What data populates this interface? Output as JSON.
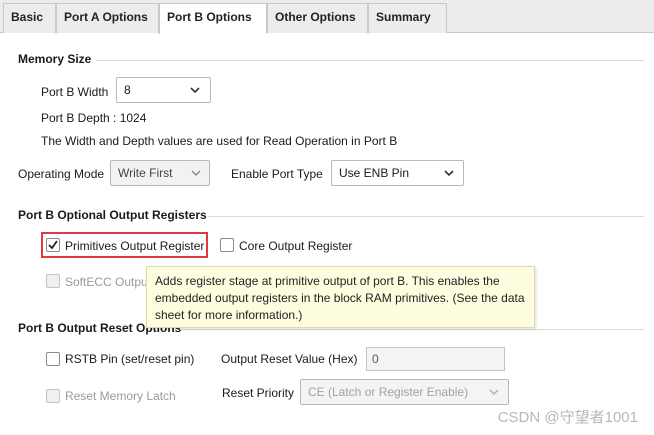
{
  "tabs": [
    {
      "label": "Basic",
      "active": false
    },
    {
      "label": "Port A Options",
      "active": false
    },
    {
      "label": "Port B Options",
      "active": true
    },
    {
      "label": "Other Options",
      "active": false
    },
    {
      "label": "Summary",
      "active": false
    }
  ],
  "memory_size": {
    "heading": "Memory Size",
    "width_label": "Port B Width",
    "width_value": "8",
    "depth_text": "Port B Depth : 1024",
    "note": "The Width and Depth values are used for Read Operation in Port B"
  },
  "operating_mode": {
    "label": "Operating Mode",
    "value": "Write First"
  },
  "enable_port_type": {
    "label": "Enable Port Type",
    "value": "Use ENB Pin"
  },
  "output_registers": {
    "heading": "Port B Optional Output Registers",
    "primitives_label": "Primitives Output Register",
    "primitives_checked": true,
    "core_label": "Core Output Register",
    "core_checked": false,
    "softecc_label": "SoftECC Output Re..."
  },
  "tooltip": {
    "text": "Adds register stage at primitive output of port B. This enables the embedded output registers in the block RAM primitives. (See the data sheet for more information.)"
  },
  "reset_options": {
    "heading": "Port B Output Reset Options",
    "rstb_label": "RSTB Pin (set/reset pin)",
    "output_reset_label": "Output Reset Value (Hex)",
    "output_reset_value": "0",
    "reset_memory_latch_label": "Reset Memory Latch",
    "reset_priority_label": "Reset Priority",
    "reset_priority_value": "CE (Latch or Register Enable)"
  },
  "watermark": "CSDN @守望者1001",
  "colors": {
    "highlight_box": "#e0393e",
    "tooltip_bg": "#fffde0",
    "tab_bar_bg": "#ececec"
  },
  "icons": {
    "dropdown": "chevron-down-icon",
    "checkbox_checked": "checkmark-icon"
  }
}
